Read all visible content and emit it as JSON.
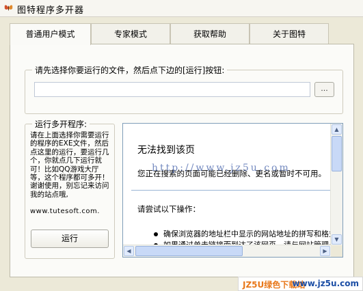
{
  "window": {
    "title": "图特程序多开器"
  },
  "tabs": [
    {
      "label": "普通用户模式",
      "active": true
    },
    {
      "label": "专家模式",
      "active": false
    },
    {
      "label": "获取帮助",
      "active": false
    },
    {
      "label": "关于图特",
      "active": false
    }
  ],
  "file_group": {
    "legend": "请先选择你要运行的文件，然后点下边的[运行]按钮:",
    "file_path": "",
    "browse_label": "..."
  },
  "run_group": {
    "legend": "运行多开程序:",
    "description": "请在上面选择你需要运行的程序的EXE文件，然后点这里的运行，要运行几个，你就点几下运行就可！比如QQ游戏大厅等，这个程序都可多开！谢谢使用，别忘记来访问我的站点哦,",
    "site_url": "www.tutesoft.com.",
    "run_label": "运行"
  },
  "browser": {
    "error_title": "无法找到该页",
    "error_desc": "您正在搜索的页面可能已经删除、更名或暂时不可用。",
    "try_heading": "请尝试以下操作：",
    "bullets": [
      "确保浏览器的地址栏中显示的网站地址的拼写和格式正确无误。",
      "如果通过单击链接而到达了该网页，请与网站管理员联系"
    ],
    "watermark": "http://www.jz5u.com"
  },
  "banner": {
    "brand": "JZ5U绿色下载站",
    "domain": "www.jz5u.com"
  },
  "colors": {
    "panel_bg": "#fbfbf8",
    "window_bg": "#ece9d8",
    "border_blue": "#7f9db9",
    "banner_orange": "#e8781b",
    "banner_blue": "#1c4ea5"
  }
}
